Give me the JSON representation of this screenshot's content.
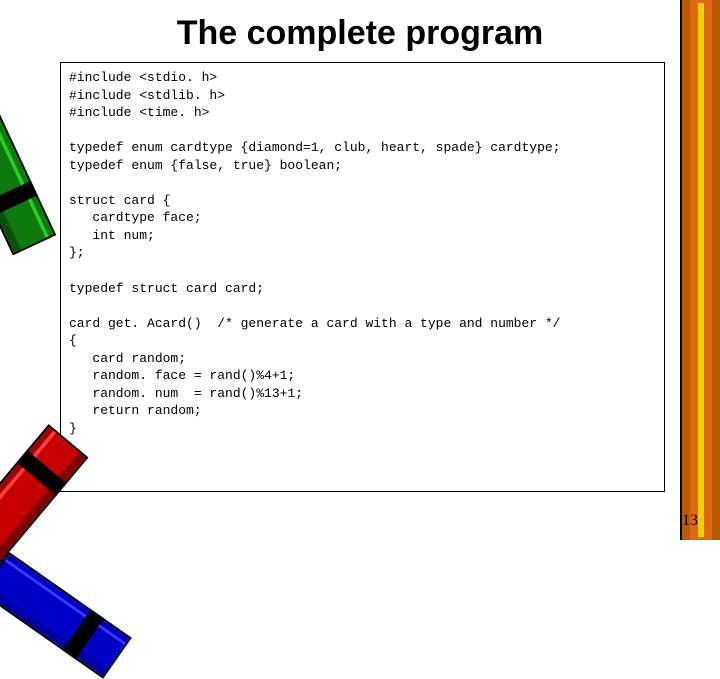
{
  "slide": {
    "title": "The complete program",
    "page_number": "13"
  },
  "code": {
    "text": "#include <stdio. h>\n#include <stdlib. h>\n#include <time. h>\n\ntypedef enum cardtype {diamond=1, club, heart, spade} cardtype;\ntypedef enum {false, true} boolean;\n\nstruct card {\n   cardtype face;\n   int num;\n};\n\ntypedef struct card card;\n\ncard get. Acard()  /* generate a card with a type and number */\n{\n   card random;\n   random. face = rand()%4+1;\n   random. num  = rand()%13+1;\n   return random;\n}"
  }
}
